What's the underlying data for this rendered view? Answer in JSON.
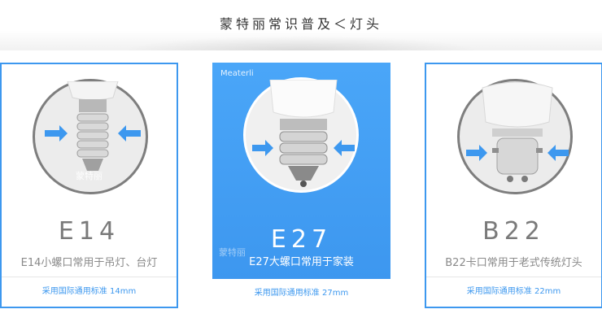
{
  "header": {
    "title": "蒙特丽常识普及＜灯头"
  },
  "cards": [
    {
      "label": "E14",
      "desc": "E14小螺口常用于吊灯、台灯",
      "footer": "采用国际通用标准 14mm",
      "watermark": "蒙特丽"
    },
    {
      "label": "E27",
      "desc": "E27大螺口常用于家装",
      "footer": "采用国际通用标准 27mm",
      "brand": "Meaterli",
      "watermark": "蒙特丽"
    },
    {
      "label": "B22",
      "desc": "B22卡口常用于老式传统灯头",
      "footer": "采用国际通用标准 22mm"
    }
  ],
  "colors": {
    "accent": "#3d98ef",
    "card_highlight": "#4aa6f8",
    "arrow": "#3d98ef"
  }
}
